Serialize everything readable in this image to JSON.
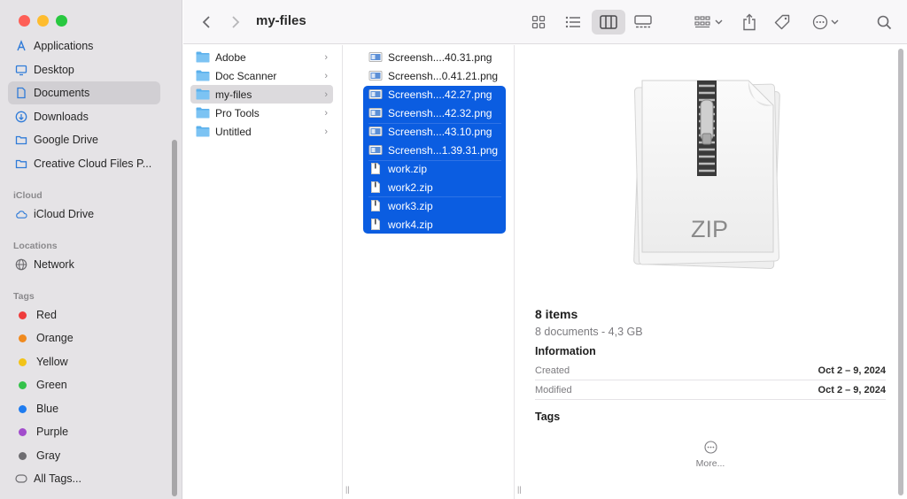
{
  "window": {
    "title": "my-files"
  },
  "traffic_colors": {
    "close": "#fe5f57",
    "minimize": "#febc2e",
    "zoom": "#28c840"
  },
  "sidebar": {
    "favorites": [
      {
        "label": "Applications",
        "icon": "applications-icon"
      },
      {
        "label": "Desktop",
        "icon": "desktop-icon"
      },
      {
        "label": "Documents",
        "icon": "document-icon",
        "selected": true
      },
      {
        "label": "Downloads",
        "icon": "download-icon"
      },
      {
        "label": "Google Drive",
        "icon": "folder-icon"
      },
      {
        "label": "Creative Cloud Files P...",
        "icon": "folder-icon"
      }
    ],
    "icloud_heading": "iCloud",
    "icloud": [
      {
        "label": "iCloud Drive",
        "icon": "cloud-icon"
      }
    ],
    "locations_heading": "Locations",
    "locations": [
      {
        "label": "Network",
        "icon": "globe-icon"
      }
    ],
    "tags_heading": "Tags",
    "tags": [
      {
        "label": "Red",
        "color": "#ef3c3c"
      },
      {
        "label": "Orange",
        "color": "#f08a1e"
      },
      {
        "label": "Yellow",
        "color": "#f2c318"
      },
      {
        "label": "Green",
        "color": "#34c24a"
      },
      {
        "label": "Blue",
        "color": "#1f7cf0"
      },
      {
        "label": "Purple",
        "color": "#a24ccc"
      },
      {
        "label": "Gray",
        "color": "#8e8e92"
      }
    ],
    "all_tags": "All Tags..."
  },
  "column1": [
    {
      "label": "Adobe"
    },
    {
      "label": "Doc Scanner"
    },
    {
      "label": "my-files",
      "selected": true
    },
    {
      "label": "Pro Tools"
    },
    {
      "label": "Untitled"
    }
  ],
  "column2": [
    {
      "label": "Screensh....40.31.png",
      "kind": "image",
      "selected": false
    },
    {
      "label": "Screensh...0.41.21.png",
      "kind": "image",
      "selected": false
    },
    {
      "label": "Screensh....42.27.png",
      "kind": "image",
      "selected": true
    },
    {
      "label": "Screensh....42.32.png",
      "kind": "image",
      "selected": true
    },
    {
      "label": "Screensh....43.10.png",
      "kind": "image",
      "selected": true
    },
    {
      "label": "Screensh...1.39.31.png",
      "kind": "image",
      "selected": true
    },
    {
      "label": "work.zip",
      "kind": "zip",
      "selected": true
    },
    {
      "label": "work2.zip",
      "kind": "zip",
      "selected": true
    },
    {
      "label": "work3.zip",
      "kind": "zip",
      "selected": true
    },
    {
      "label": "work4.zip",
      "kind": "zip",
      "selected": true
    }
  ],
  "preview": {
    "badge": "ZIP",
    "count": "8 items",
    "summary": "8 documents - 4,3 GB",
    "info_heading": "Information",
    "created_label": "Created",
    "created_value": "Oct 2 – 9, 2024",
    "modified_label": "Modified",
    "modified_value": "Oct 2 – 9, 2024",
    "tags_heading": "Tags",
    "more_label": "More..."
  },
  "toolbar_icons": [
    "back-icon",
    "forward-icon",
    "icon-view-icon",
    "list-view-icon",
    "column-view-icon",
    "gallery-view-icon",
    "group-icon",
    "share-icon",
    "tag-icon",
    "more-actions-icon",
    "search-icon"
  ]
}
